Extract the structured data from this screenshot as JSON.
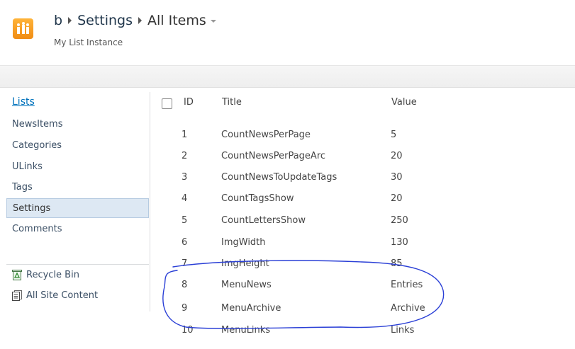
{
  "header": {
    "breadcrumb": [
      "b",
      "Settings",
      "All Items"
    ],
    "subtitle": "My List Instance",
    "logo_icon": "site-logo-icon",
    "accent": "#f39a1e"
  },
  "quicklaunch": {
    "heading": "Lists",
    "items": [
      "NewsItems",
      "Categories",
      "ULinks",
      "Tags",
      "Settings",
      "Comments"
    ],
    "selected": "Settings",
    "links": [
      {
        "label": "Recycle Bin",
        "icon": "recycle-bin-icon"
      },
      {
        "label": "All Site Content",
        "icon": "all-site-content-icon"
      }
    ]
  },
  "table": {
    "columns": [
      "ID",
      "Title",
      "Value"
    ],
    "rows": [
      {
        "id": "1",
        "title": "CountNewsPerPage",
        "value": "5"
      },
      {
        "id": "2",
        "title": "CountNewsPerPageArc",
        "value": "20"
      },
      {
        "id": "3",
        "title": "CountNewsToUpdateTags",
        "value": "30"
      },
      {
        "id": "4",
        "title": "CountTagsShow",
        "value": "20"
      },
      {
        "id": "5",
        "title": "CountLettersShow",
        "value": "250"
      },
      {
        "id": "6",
        "title": "ImgWidth",
        "value": "130"
      },
      {
        "id": "7",
        "title": "ImgHeight",
        "value": "85"
      },
      {
        "id": "8",
        "title": "MenuNews",
        "value": "Entries"
      },
      {
        "id": "9",
        "title": "MenuArchive",
        "value": "Archive"
      },
      {
        "id": "10",
        "title": "MenuLinks",
        "value": "Links"
      }
    ]
  },
  "annotation_color": "#2a3fd6"
}
